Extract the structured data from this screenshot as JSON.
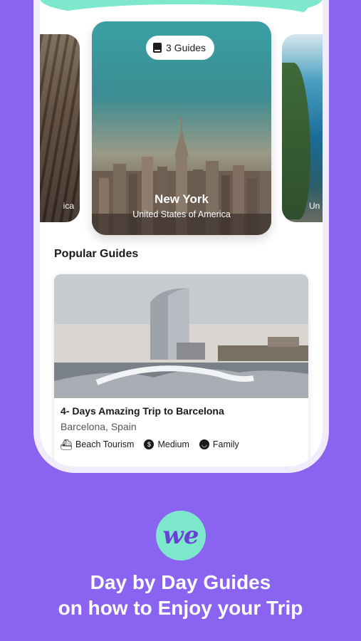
{
  "carousel": {
    "left_card": {
      "label": "ica"
    },
    "main_card": {
      "guides_count": "3 Guides",
      "city": "New York",
      "country": "United States of America"
    },
    "right_card": {
      "label": "Un"
    }
  },
  "popular": {
    "title": "Popular Guides",
    "guide": {
      "title": "4- Days Amazing Trip to Barcelona",
      "location": "Barcelona, Spain",
      "tags": [
        {
          "icon": "ship-icon",
          "label": "Beach Tourism"
        },
        {
          "icon": "coin-icon",
          "label": "Medium"
        },
        {
          "icon": "smile-icon",
          "label": "Family"
        }
      ]
    }
  },
  "branding": {
    "logo_text": "we",
    "tagline_line1": "Day by Day Guides",
    "tagline_line2": "on how to Enjoy your Trip"
  },
  "colors": {
    "background": "#8a63f0",
    "mint": "#7de8cc",
    "logo_text": "#6a3fd6"
  }
}
